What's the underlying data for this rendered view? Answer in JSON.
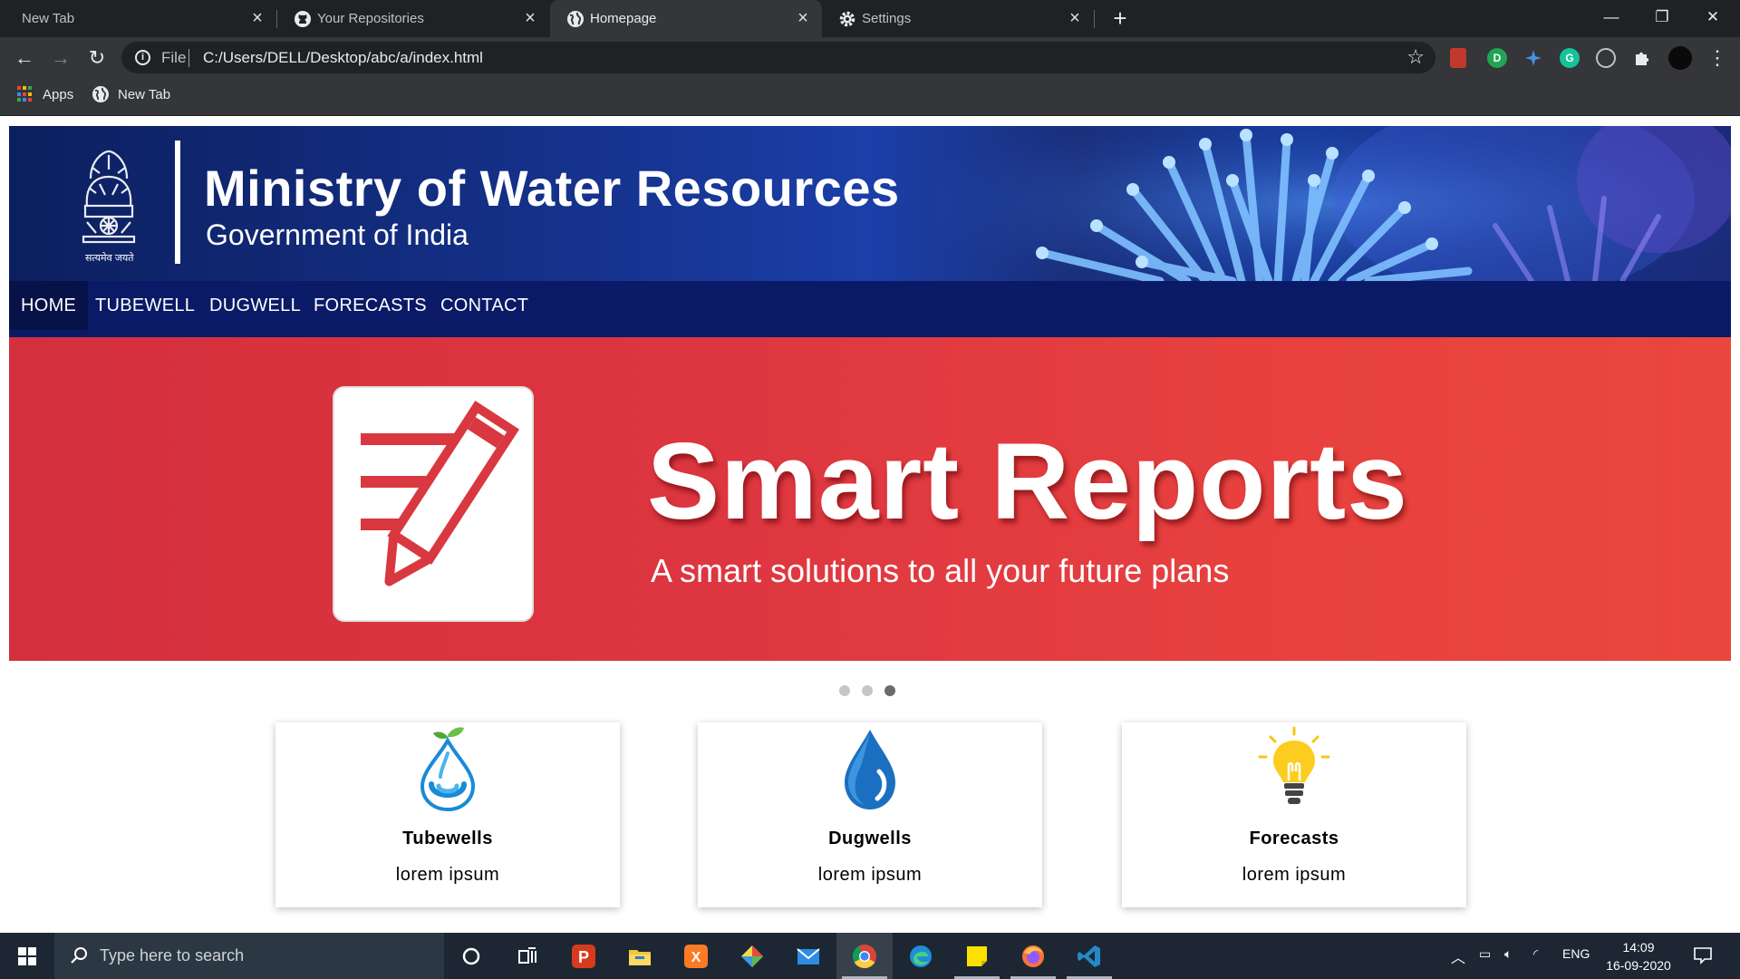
{
  "browser": {
    "tabs": [
      {
        "title": "New Tab",
        "icon": "none",
        "active": false
      },
      {
        "title": "Your Repositories",
        "icon": "github-icon",
        "active": false
      },
      {
        "title": "Homepage",
        "icon": "globe-icon",
        "active": true
      },
      {
        "title": "Settings",
        "icon": "gear-icon",
        "active": false
      }
    ],
    "new_tab_glyph": "+",
    "window_controls": {
      "minimize": "—",
      "restore": "❐",
      "close": "✕"
    },
    "address": {
      "scheme": "File",
      "url": "C:/Users/DELL/Desktop/abc/a/index.html"
    },
    "bookmarks": [
      {
        "label": "Apps",
        "icon": "apps-grid-icon"
      },
      {
        "label": "New Tab",
        "icon": "globe-icon"
      }
    ],
    "extensions": [
      "bookmark-ext-icon",
      "green-ext-icon",
      "blue-ext-icon",
      "grammarly-icon",
      "circle-ext-icon",
      "puzzle-icon",
      "profile-avatar"
    ]
  },
  "site": {
    "title": "Ministry of Water Resources",
    "subtitle": "Government of India",
    "emblem_motto": "सत्यमेव जयते",
    "nav": [
      "HOME",
      "TUBEWELL",
      "DUGWELL",
      "FORECASTS",
      "CONTACT"
    ],
    "nav_active": "HOME",
    "hero": {
      "title": "Smart Reports",
      "subtitle": "A smart solutions to all your future plans"
    },
    "carousel": {
      "slides": 3,
      "active": 3
    },
    "cards": [
      {
        "title": "Tubewells",
        "text": "lorem ipsum",
        "icon": "water-drop-sprout-icon"
      },
      {
        "title": "Dugwells",
        "text": "lorem ipsum",
        "icon": "water-drop-icon"
      },
      {
        "title": "Forecasts",
        "text": "lorem ipsum",
        "icon": "light-bulb-icon"
      }
    ]
  },
  "taskbar": {
    "search_placeholder": "Type here to search",
    "apps": [
      "cortana-icon",
      "task-view-icon",
      "psiphon-icon",
      "file-explorer-icon",
      "xampp-icon",
      "git-icon",
      "mail-icon",
      "chrome-icon",
      "edge-icon",
      "sticky-notes-icon",
      "firefox-icon",
      "vscode-icon"
    ],
    "tray": {
      "language": "ENG"
    },
    "time": "14:09",
    "date": "16-09-2020"
  },
  "colors": {
    "chrome_dark": "#202124",
    "chrome_toolbar": "#35363a",
    "header_blue": "#16338f",
    "nav_blue": "#0a1a66",
    "hero_red": "#e23b40",
    "taskbar": "#1c2733"
  }
}
